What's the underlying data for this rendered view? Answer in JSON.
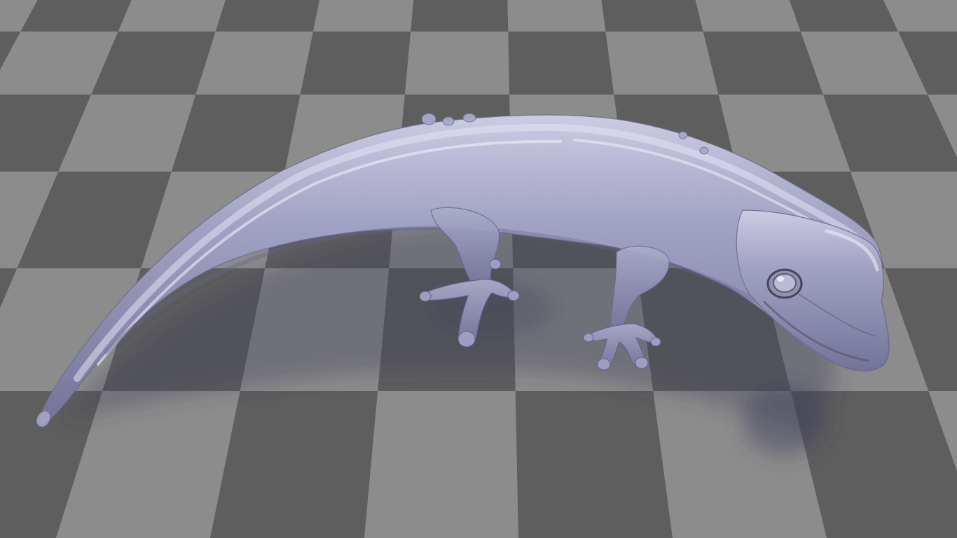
{
  "scene": {
    "subject": "gecko-figure",
    "material": "translucent-lavender-glass",
    "colors": {
      "floor_light": "#8c8c8c",
      "floor_dark": "#5e5e5e",
      "body_base": "#8c8cae",
      "body_shadow": "#6a6a8e",
      "body_highlight": "#d6d6ee",
      "eye_ring": "#3a3a52",
      "cast_shadow": "#4e4e62"
    }
  }
}
